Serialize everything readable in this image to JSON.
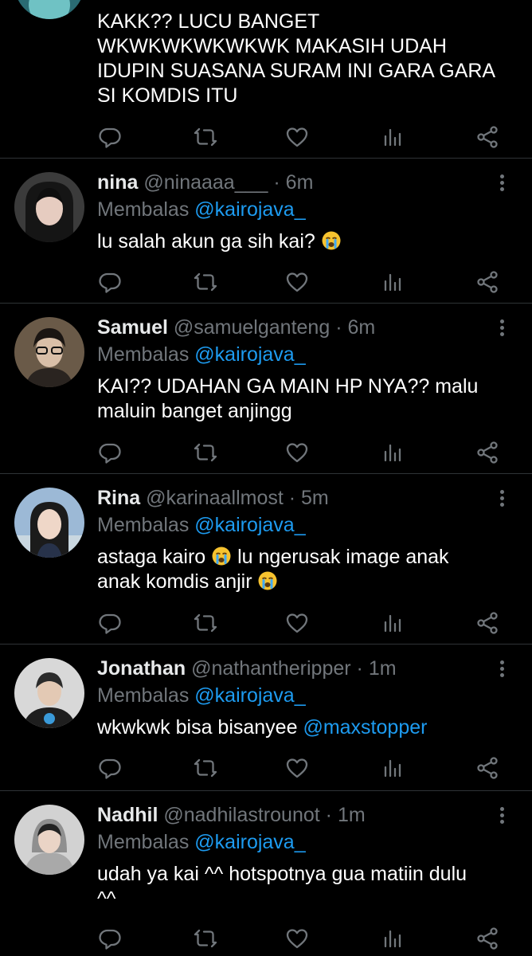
{
  "top_tweet": {
    "text": "KAKK?? LUCU BANGET\nWKWKWKWKWKWK MAKASIH UDAH\nIDUPIN SUASANA SURAM INI GARA GARA\nSI KOMDIS ITU"
  },
  "replying_label": "Membalas",
  "tweets": [
    {
      "name": "nina",
      "handle": "@ninaaaa___",
      "time": "6m",
      "reply_to": "@kairojava_",
      "text": "lu salah akun ga sih kai?",
      "emoji": "loudly-crying-face"
    },
    {
      "name": "Samuel",
      "handle": "@samuelganteng",
      "time": "6m",
      "reply_to": "@kairojava_",
      "text": "KAI?? UDAHAN GA MAIN HP NYA?? malu\nmaluin banget anjingg"
    },
    {
      "name": "Rina",
      "handle": "@karinaallmost",
      "time": "5m",
      "reply_to": "@kairojava_",
      "text_part1": "astaga kairo",
      "text_part2": "lu ngerusak image anak\nanak komdis anjir",
      "emoji": "loudly-crying-face"
    },
    {
      "name": "Jonathan",
      "handle": "@nathantheripper",
      "time": "1m",
      "reply_to": "@kairojava_",
      "text": "wkwkwk bisa bisanyee",
      "mention": "@maxstopper"
    },
    {
      "name": "Nadhil",
      "handle": "@nadhilastrounot",
      "time": "1m",
      "reply_to": "@kairojava_",
      "text": "udah ya kai ^^ hotspotnya gua matiin dulu\n^^"
    }
  ],
  "separator": "·",
  "colors": {
    "background": "#000000",
    "text": "#e7e9ea",
    "muted": "#71767b",
    "link": "#1d9bf0",
    "divider": "#2f3336"
  },
  "icons": [
    "reply-icon",
    "retweet-icon",
    "like-icon",
    "analytics-icon",
    "share-icon",
    "more-options-icon"
  ]
}
